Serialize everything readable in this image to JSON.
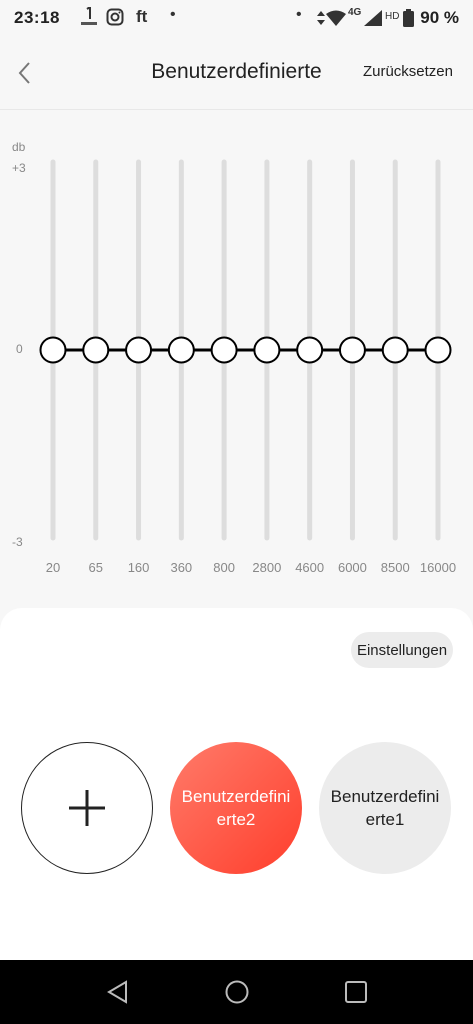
{
  "status_bar": {
    "time": "23:18",
    "icons": [
      "photo-app-icon",
      "instagram-icon",
      "ft-icon",
      "dot-icon",
      "dot-icon",
      "data-arrows-icon",
      "wifi-icon",
      "4g-icon",
      "signal-icon",
      "hd-icon",
      "battery-icon"
    ],
    "ft_label": "ft",
    "network_label": "4G",
    "hd_label": "HD",
    "battery_percent": "90 %"
  },
  "header": {
    "title": "Benutzerdefinierte",
    "reset_label": "Zurücksetzen"
  },
  "equalizer": {
    "unit_label": "db",
    "top_label": "+3",
    "mid_label": "0",
    "bottom_label": "-3",
    "range_db": [
      -3,
      3
    ],
    "bands": [
      {
        "freq": "20",
        "gain_db": 0
      },
      {
        "freq": "65",
        "gain_db": 0
      },
      {
        "freq": "160",
        "gain_db": 0
      },
      {
        "freq": "360",
        "gain_db": 0
      },
      {
        "freq": "800",
        "gain_db": 0
      },
      {
        "freq": "2800",
        "gain_db": 0
      },
      {
        "freq": "4600",
        "gain_db": 0
      },
      {
        "freq": "6000",
        "gain_db": 0
      },
      {
        "freq": "8500",
        "gain_db": 0
      },
      {
        "freq": "16000",
        "gain_db": 0
      }
    ],
    "colors": {
      "track": "#dddddd",
      "line": "#000000",
      "knob_fill": "#ffffff",
      "knob_stroke": "#000000"
    }
  },
  "presets": {
    "settings_label": "Einstellungen",
    "add_icon": "plus-icon",
    "items": [
      {
        "label": "Benutzerdefinierte2",
        "active": true
      },
      {
        "label": "Benutzerdefinierte1",
        "active": false
      }
    ],
    "accent_color": "#ff4a36"
  },
  "nav_bar": {
    "icons": [
      "back-triangle-icon",
      "home-circle-icon",
      "recents-square-icon"
    ]
  }
}
